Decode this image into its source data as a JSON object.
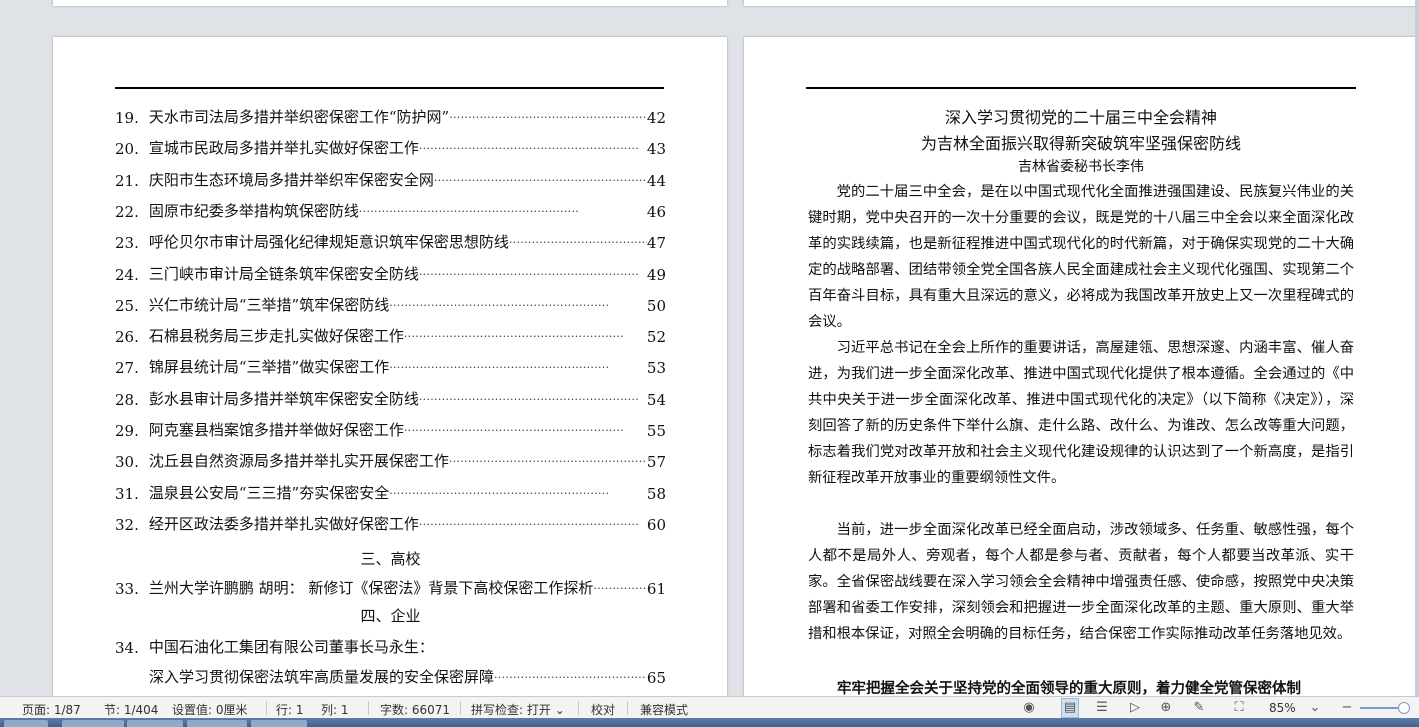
{
  "toc": {
    "entries": [
      {
        "num": "19.",
        "title": "天水市司法局多措并举织密保密工作“防护网”",
        "page": "42"
      },
      {
        "num": "20.",
        "title": "宣城市民政局多措并举扎实做好保密工作",
        "page": "43"
      },
      {
        "num": "21.",
        "title": "庆阳市生态环境局多措并举织牢保密安全网",
        "page": "44"
      },
      {
        "num": "22.",
        "title": "固原市纪委多举措构筑保密防线",
        "page": "46"
      },
      {
        "num": "23.",
        "title": "呼伦贝尔市审计局强化纪律规矩意识筑牢保密思想防线",
        "page": "47"
      },
      {
        "num": "24.",
        "title": "三门峡市审计局全链条筑牢保密安全防线",
        "page": "49"
      },
      {
        "num": "25.",
        "title": "兴仁市统计局“三举措”筑牢保密防线",
        "page": "50"
      },
      {
        "num": "26.",
        "title": "石棉县税务局三步走扎实做好保密工作",
        "page": "52"
      },
      {
        "num": "27.",
        "title": "锦屏县统计局“三举措”做实保密工作",
        "page": "53"
      },
      {
        "num": "28.",
        "title": "彭水县审计局多措并举筑牢保密安全防线",
        "page": "54"
      },
      {
        "num": "29.",
        "title": "阿克塞县档案馆多措并举做好保密工作",
        "page": "55"
      },
      {
        "num": "30.",
        "title": "沈丘县自然资源局多措并举扎实开展保密工作",
        "page": "57"
      },
      {
        "num": "31.",
        "title": "温泉县公安局“三三措”夯实保密安全",
        "page": "58"
      },
      {
        "num": "32.",
        "title": "经开区政法委多措并举扎实做好保密工作",
        "page": "60"
      }
    ],
    "section_3": "三、高校",
    "entry_33": {
      "num": "33.",
      "title": "兰州大学许鹏鹏 胡明：  新修订《保密法》背景下高校保密工作探析",
      "page": "61"
    },
    "section_4": "四、企业",
    "entry_34": {
      "num": "34.",
      "title": "中国石油化工集团有限公司董事长马永生："
    },
    "entry_34_sub": {
      "title": "深入学习贯彻保密法筑牢高质量发展的安全保密屏障",
      "page": "65"
    }
  },
  "article": {
    "title_line1": "深入学习贯彻党的二十届三中全会精神",
    "title_line2": "为吉林全面振兴取得新突破筑牢坚强保密防线",
    "author": "吉林省委秘书长李伟",
    "paragraphs": [
      "党的二十届三中全会，是在以中国式现代化全面推进强国建设、民族复兴伟业的关键时期，党中央召开的一次十分重要的会议，既是党的十八届三中全会以来全面深化改革的实践续篇，也是新征程推进中国式现代化的时代新篇，对于确保实现党的二十大确定的战略部署、团结带领全党全国各族人民全面建成社会主义现代化强国、实现第二个百年奋斗目标，具有重大且深远的意义，必将成为我国改革开放史上又一次里程碑式的会议。",
      "习近平总书记在全会上所作的重要讲话，高屋建瓴、思想深邃、内涵丰富、催人奋进，为我们进一步全面深化改革、推进中国式现代化提供了根本遵循。全会通过的《中共中央关于进一步全面深化改革、推进中国式现代化的决定》（以下简称《决定》），深刻回答了新的历史条件下举什么旗、走什么路、改什么、为谁改、怎么改等重大问题，标志着我们党对改革开放和社会主义现代化建设规律的认识达到了一个新高度，是指引新征程改革开放事业的重要纲领性文件。",
      "当前，进一步全面深化改革已经全面启动，涉改领域多、任务重、敏感性强，每个人都不是局外人、旁观者，每个人都是参与者、贡献者，每个人都要当改革派、实干家。全省保密战线要在深入学习领会全会精神中增强责任感、使命感，按照党中央决策部署和省委工作安排，深刻领会和把握进一步全面深化改革的主题、重大原则、重大举措和根本保证，对照全会明确的目标任务，结合保密工作实际推动改革任务落地见效。"
    ],
    "bold_heading": "牢牢把握全会关于坚持党的全面领导的重大原则，着力健全党管保密体制"
  },
  "statusbar": {
    "page": "页面: 1/87",
    "section": "节: 1/404",
    "setting": "设置值: 0厘米",
    "row": "行: 1",
    "col": "列: 1",
    "wordcount": "字数: 66071",
    "spellcheck": "拼写检查: 打开",
    "proof": "校对",
    "compat": "兼容模式",
    "zoom": "85%"
  },
  "icons": [
    "eye-icon",
    "page-view-icon",
    "outline-view-icon",
    "play-icon",
    "globe-icon",
    "pen-icon",
    "fit-page-icon",
    "zoom-out-icon",
    "zoom-in-icon",
    "chevron-down-icon"
  ],
  "colors": {
    "statusbar_bg": "#f3f3f3",
    "workspace_bg": "#dfe3e8",
    "taskbar": "#4a6d97",
    "active_view": "#cfdff0"
  }
}
